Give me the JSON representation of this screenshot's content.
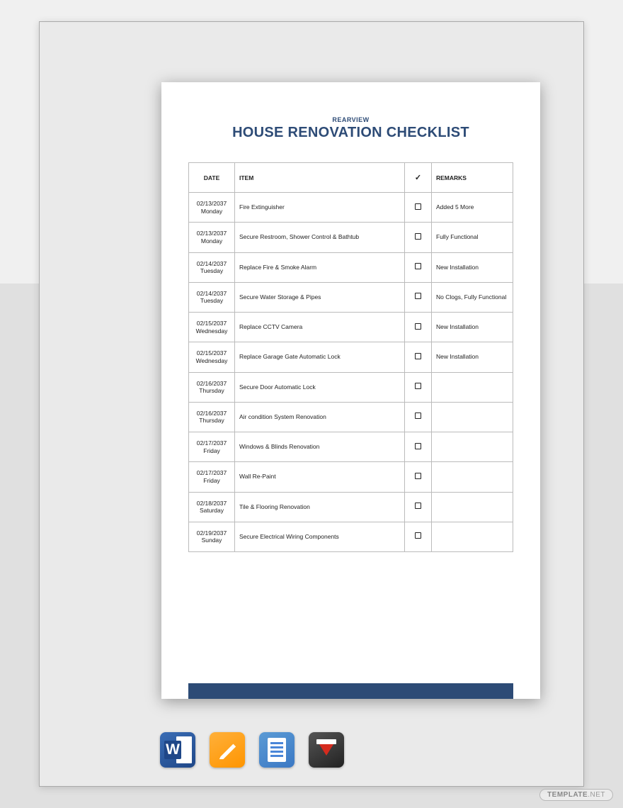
{
  "header": {
    "pretitle": "REARVIEW",
    "title": "HOUSE RENOVATION CHECKLIST"
  },
  "table": {
    "columns": {
      "date": "DATE",
      "item": "ITEM",
      "check": "✓",
      "remarks": "REMARKS"
    },
    "rows": [
      {
        "date": "02/13/2037",
        "day": "Monday",
        "item": "Fire Extinguisher",
        "remarks": "Added 5 More"
      },
      {
        "date": "02/13/2037",
        "day": "Monday",
        "item": "Secure Restroom, Shower Control & Bathtub",
        "remarks": "Fully Functional"
      },
      {
        "date": "02/14/2037",
        "day": "Tuesday",
        "item": "Replace Fire & Smoke Alarm",
        "remarks": "New Installation"
      },
      {
        "date": "02/14/2037",
        "day": "Tuesday",
        "item": "Secure Water Storage & Pipes",
        "remarks": "No Clogs, Fully Functional"
      },
      {
        "date": "02/15/2037",
        "day": "Wednesday",
        "item": "Replace CCTV Camera",
        "remarks": "New Installation"
      },
      {
        "date": "02/15/2037",
        "day": "Wednesday",
        "item": "Replace Garage Gate Automatic Lock",
        "remarks": "New Installation"
      },
      {
        "date": "02/16/2037",
        "day": "Thursday",
        "item": "Secure Door Automatic Lock",
        "remarks": ""
      },
      {
        "date": "02/16/2037",
        "day": "Thursday",
        "item": "Air condition System Renovation",
        "remarks": ""
      },
      {
        "date": "02/17/2037",
        "day": "Friday",
        "item": "Windows & Blinds Renovation",
        "remarks": ""
      },
      {
        "date": "02/17/2037",
        "day": "Friday",
        "item": "Wall Re-Paint",
        "remarks": ""
      },
      {
        "date": "02/18/2037",
        "day": "Saturday",
        "item": "Tile & Flooring Renovation",
        "remarks": ""
      },
      {
        "date": "02/19/2037",
        "day": "Sunday",
        "item": "Secure Electrical Wiring Components",
        "remarks": ""
      }
    ]
  },
  "icons": {
    "word": "word-icon",
    "pages": "pages-icon",
    "docs": "google-docs-icon",
    "pdf": "pdf-icon"
  },
  "watermark": {
    "brand": "TEMPLATE",
    "suffix": ".NET"
  }
}
